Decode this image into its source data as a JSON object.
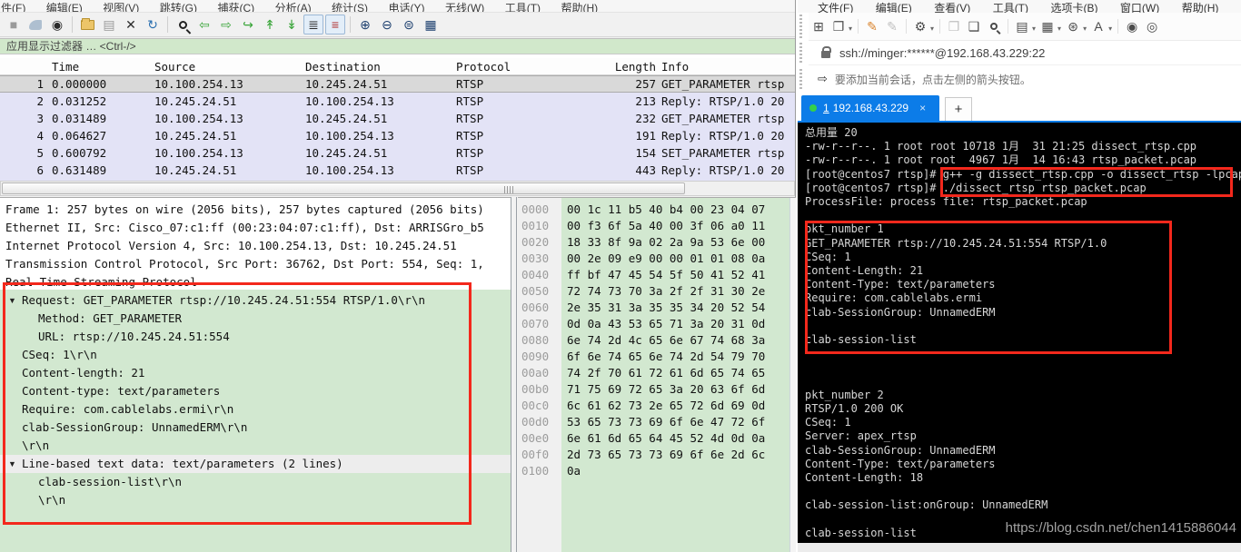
{
  "wireshark": {
    "menu": {
      "file": "件(F)",
      "edit": "编辑(E)",
      "view": "视图(V)",
      "go": "跳转(G)",
      "capture": "捕获(C)",
      "analyze": "分析(A)",
      "statistics": "统计(S)",
      "telephony": "电话(Y)",
      "wireless": "无线(W)",
      "tools": "工具(T)",
      "help": "帮助(H)"
    },
    "filter_placeholder": "应用显示过滤器 … <Ctrl-/>",
    "packet_list": {
      "columns": {
        "time": "Time",
        "source": "Source",
        "destination": "Destination",
        "protocol": "Protocol",
        "length": "Length",
        "info": "Info"
      },
      "rows": [
        {
          "no": "1",
          "time": "0.000000",
          "source": "10.100.254.13",
          "destination": "10.245.24.51",
          "protocol": "RTSP",
          "length": "257",
          "info": "GET_PARAMETER rtsp"
        },
        {
          "no": "2",
          "time": "0.031252",
          "source": "10.245.24.51",
          "destination": "10.100.254.13",
          "protocol": "RTSP",
          "length": "213",
          "info": "Reply: RTSP/1.0 20"
        },
        {
          "no": "3",
          "time": "0.031489",
          "source": "10.100.254.13",
          "destination": "10.245.24.51",
          "protocol": "RTSP",
          "length": "232",
          "info": "GET_PARAMETER rtsp"
        },
        {
          "no": "4",
          "time": "0.064627",
          "source": "10.245.24.51",
          "destination": "10.100.254.13",
          "protocol": "RTSP",
          "length": "191",
          "info": "Reply: RTSP/1.0 20"
        },
        {
          "no": "5",
          "time": "0.600792",
          "source": "10.100.254.13",
          "destination": "10.245.24.51",
          "protocol": "RTSP",
          "length": "154",
          "info": "SET_PARAMETER rtsp"
        },
        {
          "no": "6",
          "time": "0.631489",
          "source": "10.245.24.51",
          "destination": "10.100.254.13",
          "protocol": "RTSP",
          "length": "443",
          "info": "Reply: RTSP/1.0 20"
        }
      ]
    },
    "details": {
      "frame": "Frame 1: 257 bytes on wire (2056 bits), 257 bytes captured (2056 bits)",
      "ethernet": "Ethernet II, Src: Cisco_07:c1:ff (00:23:04:07:c1:ff), Dst: ARRISGro_b5",
      "ip": "Internet Protocol Version 4, Src: 10.100.254.13, Dst: 10.245.24.51",
      "tcp": "Transmission Control Protocol, Src Port: 36762, Dst Port: 554, Seq: 1,",
      "rtsp": "Real Time Streaming Protocol",
      "request": "Request: GET_PARAMETER rtsp://10.245.24.51:554 RTSP/1.0\\r\\n",
      "method": "Method: GET_PARAMETER",
      "url": "URL: rtsp://10.245.24.51:554",
      "cseq": "CSeq: 1\\r\\n",
      "content_length": "Content-length: 21",
      "content_type": "Content-type: text/parameters",
      "require": "Require: com.cablelabs.ermi\\r\\n",
      "session_group": "clab-SessionGroup: UnnamedERM\\r\\n",
      "crlf1": "\\r\\n",
      "line_based": "Line-based text data: text/parameters (2 lines)",
      "session_list": "clab-session-list\\r\\n",
      "crlf2": "\\r\\n"
    },
    "hex_rows": [
      {
        "offset": "0000",
        "bytes": "00 1c 11 b5 40 b4 00 23  04 07"
      },
      {
        "offset": "0010",
        "bytes": "00 f3 6f 5a 40 00 3f 06  a0 11"
      },
      {
        "offset": "0020",
        "bytes": "18 33 8f 9a 02 2a 9a 53  6e 00"
      },
      {
        "offset": "0030",
        "bytes": "00 2e 09 e9 00 00 01 01  08 0a"
      },
      {
        "offset": "0040",
        "bytes": "ff bf 47 45 54 5f 50 41  52 41"
      },
      {
        "offset": "0050",
        "bytes": "72 74 73 70 3a 2f 2f 31  30 2e"
      },
      {
        "offset": "0060",
        "bytes": "2e 35 31 3a 35 35 34 20  52 54"
      },
      {
        "offset": "0070",
        "bytes": "0d 0a 43 53 65 71 3a 20  31 0d"
      },
      {
        "offset": "0080",
        "bytes": "6e 74 2d 4c 65 6e 67 74  68 3a"
      },
      {
        "offset": "0090",
        "bytes": "6f 6e 74 65 6e 74 2d 54  79 70"
      },
      {
        "offset": "00a0",
        "bytes": "74 2f 70 61 72 61 6d 65  74 65"
      },
      {
        "offset": "00b0",
        "bytes": "71 75 69 72 65 3a 20 63  6f 6d"
      },
      {
        "offset": "00c0",
        "bytes": "6c 61 62 73 2e 65 72 6d  69 0d"
      },
      {
        "offset": "00d0",
        "bytes": "53 65 73 73 69 6f 6e 47  72 6f"
      },
      {
        "offset": "00e0",
        "bytes": "6e 61 6d 65 64 45 52 4d  0d 0a"
      },
      {
        "offset": "00f0",
        "bytes": "2d 73 65 73 73 69 6f 6e  2d 6c"
      },
      {
        "offset": "0100",
        "bytes": "0a"
      }
    ]
  },
  "xshell": {
    "menu": {
      "file": "文件(F)",
      "edit": "编辑(E)",
      "view": "查看(V)",
      "tools": "工具(T)",
      "tabs": "选项卡(B)",
      "window": "窗口(W)",
      "help": "帮助(H)"
    },
    "address": "ssh://minger:******@192.168.43.229:22",
    "notice": "要添加当前会话，点击左侧的箭头按钮。",
    "tab": {
      "number": "1",
      "host": "192.168.43.229",
      "close": "×",
      "new": "+"
    },
    "terminal_output": "总用量 20\n-rw-r--r--. 1 root root 10718 1月  31 21:25 dissect_rtsp.cpp\n-rw-r--r--. 1 root root  4967 1月  14 16:43 rtsp_packet.pcap\n[root@centos7 rtsp]# g++ -g dissect_rtsp.cpp -o dissect_rtsp -lpcap\n[root@centos7 rtsp]# ./dissect_rtsp rtsp_packet.pcap\nProcessFile: process file: rtsp_packet.pcap\n\npkt_number 1\nGET_PARAMETER rtsp://10.245.24.51:554 RTSP/1.0\nCSeq: 1\nContent-Length: 21\nContent-Type: text/parameters\nRequire: com.cablelabs.ermi\nclab-SessionGroup: UnnamedERM\n\nclab-session-list\n\n\n\npkt_number 2\nRTSP/1.0 200 OK\nCSeq: 1\nServer: apex_rtsp\nclab-SessionGroup: UnnamedERM\nContent-Type: text/parameters\nContent-Length: 18\n\nclab-session-list:onGroup: UnnamedERM\n\nclab-session-list",
    "watermark": "https://blog.csdn.net/chen1415886044"
  },
  "glyphs": {
    "stop": "■",
    "save": "▤",
    "close": "✕",
    "reload": "↻",
    "back": "⇦",
    "forward": "⇨",
    "goto": "↪",
    "top": "↟",
    "bottom": "↡",
    "autoscroll": "≣",
    "colorize": "≡",
    "zoom_in": "⊕",
    "zoom_out": "⊖",
    "zoom_reset": "⊜",
    "resize_cols": "▦",
    "expand": "▼",
    "new_session": "⊞",
    "open_folder": "❐",
    "connect": "✎",
    "disconnect": "✎",
    "settings": "⚙",
    "copy": "❐",
    "paste": "❑",
    "print": "▤",
    "layout": "▦",
    "globe": "⊛",
    "font": "A",
    "sound": "◉",
    "eye": "◎",
    "caret": "▾",
    "info_arrow": "⇨"
  },
  "colors": {
    "accent_blue": "#0c7ce8",
    "annotation_red": "#f3281c",
    "rtsp_row": "#e3e3f6",
    "field_green": "#d2e8d0",
    "tab_dot_green": "#35d04a"
  }
}
